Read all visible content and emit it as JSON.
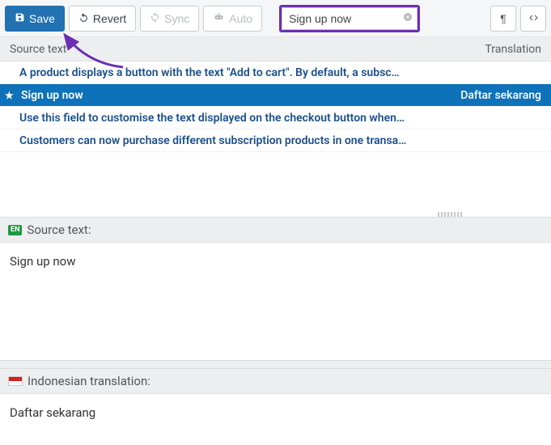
{
  "toolbar": {
    "save_label": "Save",
    "revert_label": "Revert",
    "sync_label": "Sync",
    "auto_label": "Auto"
  },
  "search": {
    "value": "Sign up now"
  },
  "headers": {
    "source": "Source text",
    "translation": "Translation"
  },
  "rows": [
    {
      "source": "A product displays a button with the text \"Add to cart\". By default, a subsc…",
      "translation": "",
      "selected": false
    },
    {
      "source": "Sign up now",
      "translation": "Daftar sekarang",
      "selected": true
    },
    {
      "source": "Use this field to customise the text displayed on the checkout button when…",
      "translation": "",
      "selected": false
    },
    {
      "source": "Customers can now purchase different subscription products in one transa…",
      "translation": "",
      "selected": false
    }
  ],
  "source_pane": {
    "badge": "EN",
    "label": "Source text:",
    "value": "Sign up now"
  },
  "translation_pane": {
    "label": "Indonesian translation:",
    "value": "Daftar sekarang"
  }
}
